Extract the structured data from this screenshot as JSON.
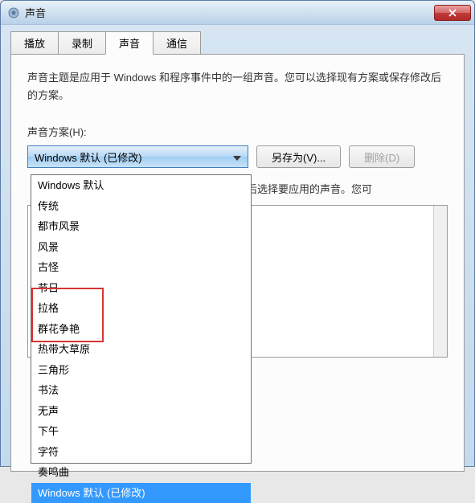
{
  "window": {
    "title": "声音"
  },
  "tabs": [
    {
      "label": "播放"
    },
    {
      "label": "录制"
    },
    {
      "label": "声音",
      "active": true
    },
    {
      "label": "通信"
    }
  ],
  "content": {
    "description": "声音主题是应用于 Windows 和程序事件中的一组声音。您可以选择现有方案或保存修改后的方案。",
    "scheme_label": "声音方案(H):",
    "scheme_selected": "Windows 默认 (已修改)",
    "save_as_label": "另存为(V)...",
    "delete_label": "删除(D)",
    "events_description_fragment": "件，然后选择要应用的声音。您可"
  },
  "dropdown": {
    "options": [
      "Windows 默认",
      "传统",
      "都市风景",
      "风景",
      "古怪",
      "节日",
      "拉格",
      "群花争艳",
      "热带大草原",
      "三角形",
      "书法",
      "无声",
      "下午",
      "字符",
      "奏鸣曲",
      "Windows 默认 (已修改)"
    ],
    "highlighted_index": 15
  }
}
